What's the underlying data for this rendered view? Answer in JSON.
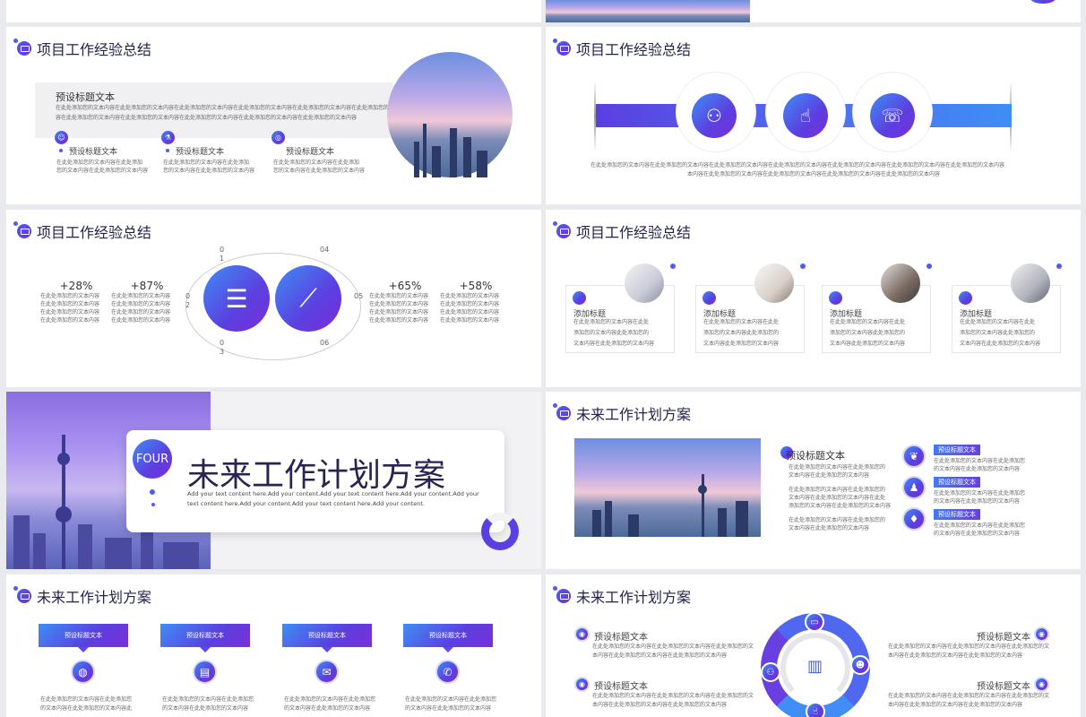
{
  "top": {},
  "s1": {
    "title": "项目工作经验总结",
    "heading": "预设标题文本",
    "para1": "在此处添加您的文本内容在此处添加您的文本内容在此处添加您的文本内容在此处添加您的文本内容在此处添加您的文本内容在此处添加您的文本内容",
    "para2": "容在此处添加您的文本内容在此处添加您的文本内容在此处添加您的文本内容在此处添加您的文本内容在此处添加您的文本内容",
    "items": [
      {
        "label": "预设标题文本",
        "text1": "在此处添加您的文本内容在此处添加",
        "text2": "您的文本内容在此处添加您的文本内容"
      },
      {
        "label": "预设标题文本",
        "text1": "在此处添加您的文本内容在此处添加",
        "text2": "您的文本内容在此处添加您的文本内容"
      },
      {
        "label": "预设标题文本",
        "text1": "在此处添加您的文本内容在此处添加",
        "text2": "您的文本内容在此处添加您的文本内容"
      }
    ]
  },
  "s2": {
    "title": "项目工作经验总结",
    "line1": "在此处添加您的文本内容在此处添加您的文本内容在此处添加您的文本内容在此处添加您的文本内容在此处添加您的文本内容在此处添加您的文本内容在此处添加您的文本内容",
    "line2": "本内容在此处添加您的文本内容在此处添加您的文本内容在此处添加您的文本内容在此处添加您的文本内容"
  },
  "s3": {
    "title": "项目工作经验总结",
    "stats": [
      {
        "value": "+28%"
      },
      {
        "value": "+87%"
      },
      {
        "value": "+65%"
      },
      {
        "value": "+58%"
      }
    ],
    "statline": "在此处添加您的文本内容",
    "nums": {
      "n01a": "0",
      "n01b": "1",
      "n02a": "0",
      "n02b": "2",
      "n03a": "0",
      "n03b": "3",
      "n04": "04",
      "n05": "05",
      "n06": "06"
    }
  },
  "s4": {
    "title": "项目工作经验总结",
    "cards": [
      {
        "label": "添加标题",
        "t1": "在此处添加您的文本内容在此处",
        "t2": "添加您的文本内容此处添加您的",
        "t3": "文本内容在此处添加您的文本内容"
      },
      {
        "label": "添加标题",
        "t1": "在此处添加您的文本内容在此处",
        "t2": "添加您的文本内容此处添加您的",
        "t3": "文本内容此处添加您的文本内容"
      },
      {
        "label": "添加标题",
        "t1": "在此处添加您的文本内容在此处",
        "t2": "添加您的文本内容此处添加您的",
        "t3": "文本内容此处添加您的文本内容"
      },
      {
        "label": "添加标题",
        "t1": "在此处添加您的文本内容在此处",
        "t2": "添加您的文本内容此处添加您的",
        "t3": "文本内容在此处添加您的文本内容"
      }
    ]
  },
  "s5": {
    "badge": "FOUR",
    "title": "未来工作计划方案",
    "sub1": "Add your text content here.Add your content.Add your text content here.Add your content.Add your",
    "sub2": "text content here.Add your content.Add your text content here.Add your content."
  },
  "s6": {
    "title": "未来工作计划方案",
    "heading": "预设标题文本",
    "paras": [
      {
        "a": "在此处添加您的文本内容在此处添加您的",
        "b": "文本内容在此处添加您的文本内容"
      },
      {
        "a": "在此处添加您的文本内容在此处添加您的",
        "b": "文本内容在此处添加您的文本内容在此处",
        "c": "添加您的文本内容在此处添加您的文本内容"
      },
      {
        "a": "在此处添加您的文本内容在此处添加您的",
        "b": "文本内容在此处添加您的文本内容"
      }
    ],
    "tags": [
      {
        "label": "预设标题文本",
        "a": "在此处添加您的文本内容在此处添加您",
        "b": "的文本内容在此处添加您的文本内容"
      },
      {
        "label": "预设标题文本",
        "a": "在此处添加您的文本内容在此处添加您",
        "b": "的文本内容在此处添加您的文本内容"
      },
      {
        "label": "预设标题文本",
        "a": "在此处添加您的文本内容在此处添加您",
        "b": "的文本内容在此处添加您的文本内容"
      }
    ]
  },
  "s7": {
    "title": "未来工作计划方案",
    "cols": [
      {
        "label": "预设标题文本",
        "a": "在此处添加您的文本内容在此处添加您",
        "b": "的文本内容在此处添加您的文本内容此"
      },
      {
        "label": "预设标题文本",
        "a": "在此处添加您的文本内容在此处添加您",
        "b": "的文本内容在此处添加您的文本内容"
      },
      {
        "label": "预设标题文本",
        "a": "在此处添加您的文本内容在此处添加您",
        "b": "的文本内容在此处添加您的文本内容"
      },
      {
        "label": "预设标题文本",
        "a": "在此处添加您的文本内容在此处添加您",
        "b": "的文本内容在此处添加您的文本内容"
      }
    ]
  },
  "s8": {
    "title": "未来工作计划方案",
    "items": [
      {
        "label": "预设标题文本",
        "a": "在此处添加您的文本内容在此处添加您的文本内容在此处添加您的文",
        "b": "本内容在此处添加您的文本内容在此处添加您的文本内容"
      },
      {
        "label": "预设标题文本",
        "a": "在此处添加您的文本内容在此处添加您的文本内容在此处添加您的文",
        "b": "本内容在此处添加您的文本内容在此处添加您的文本内容"
      },
      {
        "label": "预设标题文本",
        "a": "在此处添加您的文本内容在此处添加您的文本内容在此处添加您的文",
        "b": "本内容在此处添加您的文本内容在此处添加您的文本内容"
      },
      {
        "label": "预设标题文本",
        "a": "在此处添加您的文本内容在此处添加您的文本内容在此处添加您的文",
        "b": "本内容在此处添加您的文本内容在此处添加您的文本内容"
      }
    ]
  }
}
